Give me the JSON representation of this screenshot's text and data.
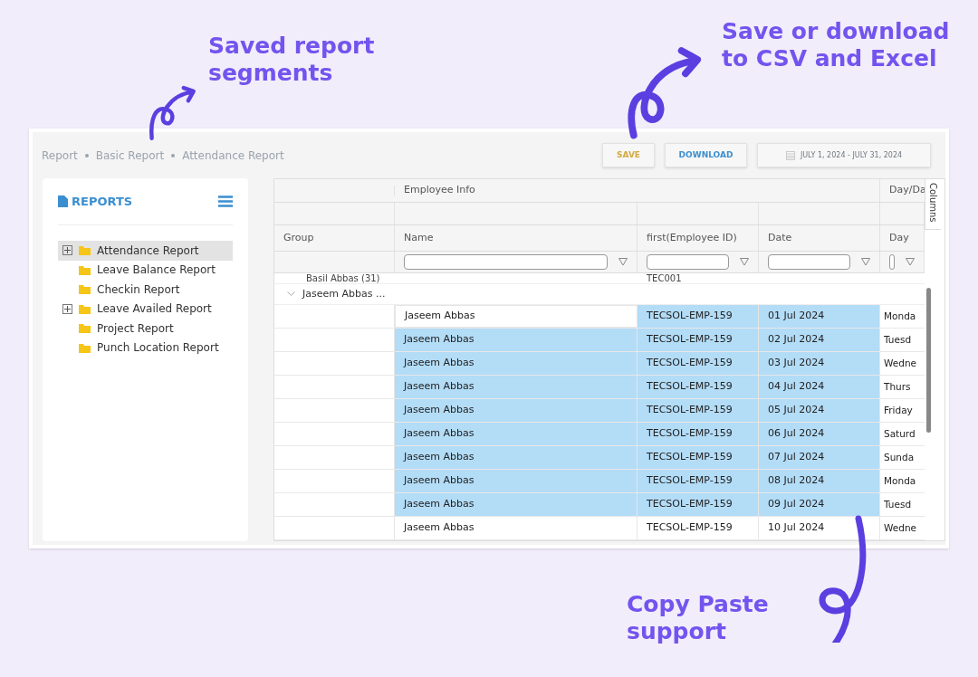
{
  "annotations": [
    {
      "text": "Saved report segments"
    },
    {
      "text": "Save or download to CSV and Excel"
    },
    {
      "text": "Copy Paste support"
    }
  ],
  "breadcrumb": [
    "Report",
    "Basic Report",
    "Attendance Report"
  ],
  "toolbar": {
    "save": "SAVE",
    "download": "DOWNLOAD",
    "date_range": "JULY 1, 2024 - JULY 31, 2024"
  },
  "sidebar": {
    "title": "REPORTS",
    "items": [
      {
        "label": "Attendance Report",
        "expandable": true,
        "selected": true
      },
      {
        "label": "Leave Balance Report",
        "expandable": false,
        "selected": false
      },
      {
        "label": "Checkin Report",
        "expandable": false,
        "selected": false
      },
      {
        "label": "Leave Availed Report",
        "expandable": true,
        "selected": false
      },
      {
        "label": "Project Report",
        "expandable": false,
        "selected": false
      },
      {
        "label": "Punch Location Report",
        "expandable": false,
        "selected": false
      }
    ]
  },
  "grid": {
    "group_headers": [
      "Employee Info",
      "Day/Da"
    ],
    "columns": [
      "Group",
      "Name",
      "first(Employee ID)",
      "Date",
      "Day"
    ],
    "side_tab": "Columns",
    "partial_group": {
      "label": "Basil Abbas (31)",
      "id": "TEC001"
    },
    "group": {
      "label": "Jaseem Abbas ...",
      "expanded": true
    },
    "rows": [
      {
        "name": "Jaseem Abbas",
        "id": "TECSOL-EMP-159",
        "date": "01 Jul 2024",
        "day": "Monda",
        "selected": true,
        "focused": true
      },
      {
        "name": "Jaseem Abbas",
        "id": "TECSOL-EMP-159",
        "date": "02 Jul 2024",
        "day": "Tuesd",
        "selected": true,
        "focused": false
      },
      {
        "name": "Jaseem Abbas",
        "id": "TECSOL-EMP-159",
        "date": "03 Jul 2024",
        "day": "Wedne",
        "selected": true,
        "focused": false
      },
      {
        "name": "Jaseem Abbas",
        "id": "TECSOL-EMP-159",
        "date": "04 Jul 2024",
        "day": "Thurs",
        "selected": true,
        "focused": false
      },
      {
        "name": "Jaseem Abbas",
        "id": "TECSOL-EMP-159",
        "date": "05 Jul 2024",
        "day": "Friday",
        "selected": true,
        "focused": false
      },
      {
        "name": "Jaseem Abbas",
        "id": "TECSOL-EMP-159",
        "date": "06 Jul 2024",
        "day": "Saturd",
        "selected": true,
        "focused": false
      },
      {
        "name": "Jaseem Abbas",
        "id": "TECSOL-EMP-159",
        "date": "07 Jul 2024",
        "day": "Sunda",
        "selected": true,
        "focused": false
      },
      {
        "name": "Jaseem Abbas",
        "id": "TECSOL-EMP-159",
        "date": "08 Jul 2024",
        "day": "Monda",
        "selected": true,
        "focused": false
      },
      {
        "name": "Jaseem Abbas",
        "id": "TECSOL-EMP-159",
        "date": "09 Jul 2024",
        "day": "Tuesd",
        "selected": true,
        "focused": false
      },
      {
        "name": "Jaseem Abbas",
        "id": "TECSOL-EMP-159",
        "date": "10 Jul 2024",
        "day": "Wedne",
        "selected": false,
        "focused": false
      }
    ]
  }
}
